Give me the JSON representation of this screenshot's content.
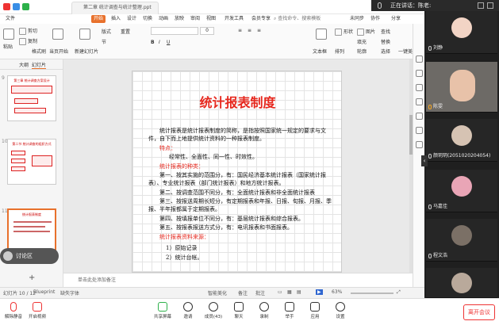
{
  "system": {
    "doc_tab_label": "第二章 统计调查与统计整理.ppt",
    "speaking": "正在讲话：陈老:"
  },
  "menu": {
    "items": [
      "文件",
      "开始",
      "插入",
      "设计",
      "切换",
      "动画",
      "放映",
      "审阅",
      "视图",
      "开发工具",
      "会员专享"
    ],
    "active": "开始",
    "search_label": "查找命令、搜索模板",
    "right_items": [
      "未同步",
      "协作",
      "分享"
    ]
  },
  "ribbon": {
    "paste": "粘贴",
    "cut": "剪切",
    "copy": "复制",
    "format_painter": "格式刷",
    "from_current": "当页开始",
    "new_slide": "新建幻灯片",
    "layout": "版式",
    "section": "节",
    "reset": "重置",
    "font_size": "0",
    "text_box": "文本框",
    "shape": "形状",
    "arrange": "排列",
    "picture": "图片",
    "fill": "填充",
    "outline": "轮廓",
    "find": "查找",
    "replace": "替换",
    "select": "选择",
    "effects": "形状效果",
    "smart": "智能图形",
    "beautify": "一键美化"
  },
  "left_panel": {
    "tab_outline": "大纲",
    "tab_slides": "幻灯片",
    "slides": [
      {
        "num": "9",
        "title": "第三章 统计调查方案设计"
      },
      {
        "num": "10",
        "title": "第二节 统计调查的组织方式"
      },
      {
        "num": "11",
        "title": "统计报表制度"
      }
    ],
    "discuss_label": "讨论区",
    "add_slide": "+"
  },
  "slide": {
    "title": "统计报表制度",
    "intro": "统计报表是统计报表制度的简称，是指按照国家统一规定的要求与文件，自下而上地提供统计资料的一种报表制度。",
    "features_label": "特点：",
    "features": "经常性、全面性、同一性、时效性。",
    "types_label": "统计报表的种类：",
    "types": [
      "第一、按其实施的范围分，有：国民经济基本统计报表（国家统计报表）、专业统计报表（部门统计报表）和地方统计报表。",
      "第二、按调查范围不同分，有：全面统计报表和非全面统计报表",
      "第三、按报送周期长短分，有定期报表和年报、日报、旬报、月报、季报、半年报都属于定期报表。",
      "第四、按填报单位不同分，有：基层统计报表和综合报表。",
      "第五、按报表报送方式分，有：电讯报表和书面报表。"
    ],
    "sources_label": "统计报表资料来源：",
    "sources": [
      "1）原始记录",
      "2）统计台帐。"
    ]
  },
  "notes": {
    "placeholder": "单击此处添加备注"
  },
  "status": {
    "page": "幻灯片 10 / 12",
    "theme": "Blueprint",
    "missing_font": "缺失字体",
    "smart_beautify": "智能美化",
    "notes_btn": "备注",
    "comment_btn": "批注",
    "zoom": "63%"
  },
  "participants": [
    {
      "name": "刘静"
    },
    {
      "name": "陈雯"
    },
    {
      "name": "颜玥玥(2051020204054)"
    },
    {
      "name": "马嘉佳"
    },
    {
      "name": "程文浩"
    },
    {
      "name": "某同学"
    }
  ],
  "meeting": {
    "mute": "解除静音",
    "video": "开启视频",
    "share": "共享屏幕",
    "invite": "邀请",
    "members": "成员(43)",
    "chat": "聊天",
    "record": "录制",
    "raise_hand": "举手",
    "apps": "应用",
    "settings": "设置",
    "leave": "离开会议"
  },
  "colors": {
    "accent": "#e8712c",
    "slide_title": "#e6281e",
    "end_button": "#e33333"
  }
}
